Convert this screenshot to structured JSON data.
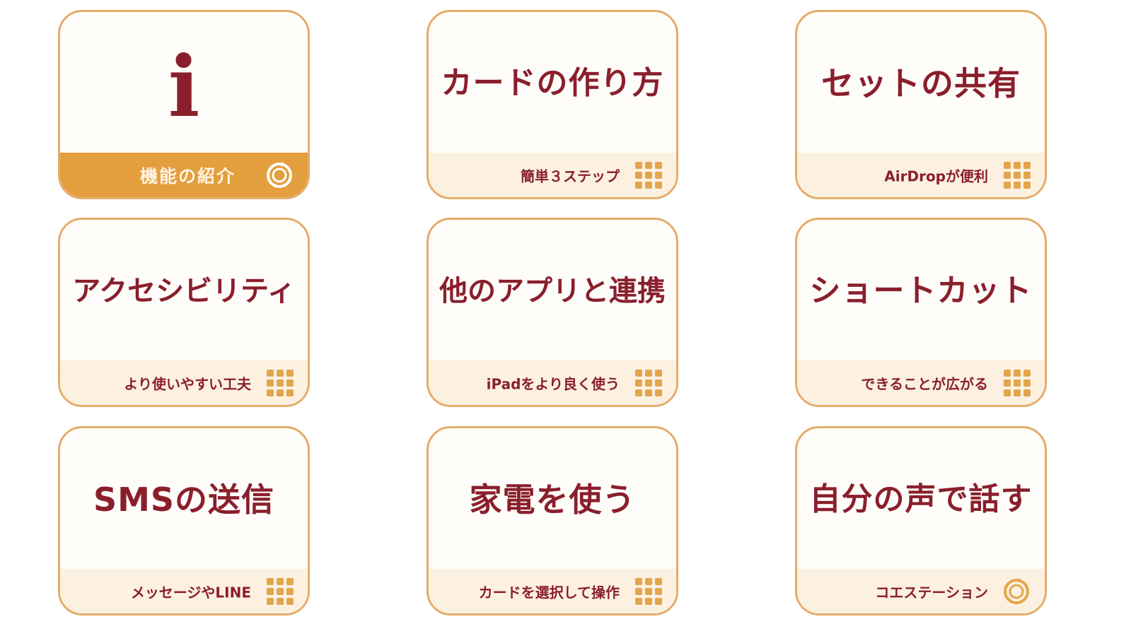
{
  "colors": {
    "border": "#e3ad6a",
    "title": "#8a1f2c",
    "footer_bg": "#fcf1e1",
    "active_footer_bg": "#e39e3e",
    "icon": "#e3a54b"
  },
  "tiles": [
    {
      "title": "i",
      "subtitle": "機能の紹介",
      "icon": "refresh-ring-icon",
      "active": true
    },
    {
      "title": "カードの作り方",
      "subtitle": "簡単３ステップ",
      "icon": "grid-icon",
      "active": false
    },
    {
      "title": "セットの共有",
      "subtitle": "AirDropが便利",
      "icon": "grid-icon",
      "active": false
    },
    {
      "title": "アクセシビリティ",
      "subtitle": "より使いやすい工夫",
      "icon": "grid-icon",
      "active": false
    },
    {
      "title": "他のアプリと連携",
      "subtitle": "iPadをより良く使う",
      "icon": "grid-icon",
      "active": false
    },
    {
      "title": "ショートカット",
      "subtitle": "できることが広がる",
      "icon": "grid-icon",
      "active": false
    },
    {
      "title": "SMSの送信",
      "subtitle": "メッセージやLINE",
      "icon": "grid-icon",
      "active": false
    },
    {
      "title": "家電を使う",
      "subtitle": "カードを選択して操作",
      "icon": "grid-icon",
      "active": false
    },
    {
      "title": "自分の声で話す",
      "subtitle": "コエステーション",
      "icon": "refresh-ring-icon",
      "active": false
    }
  ]
}
